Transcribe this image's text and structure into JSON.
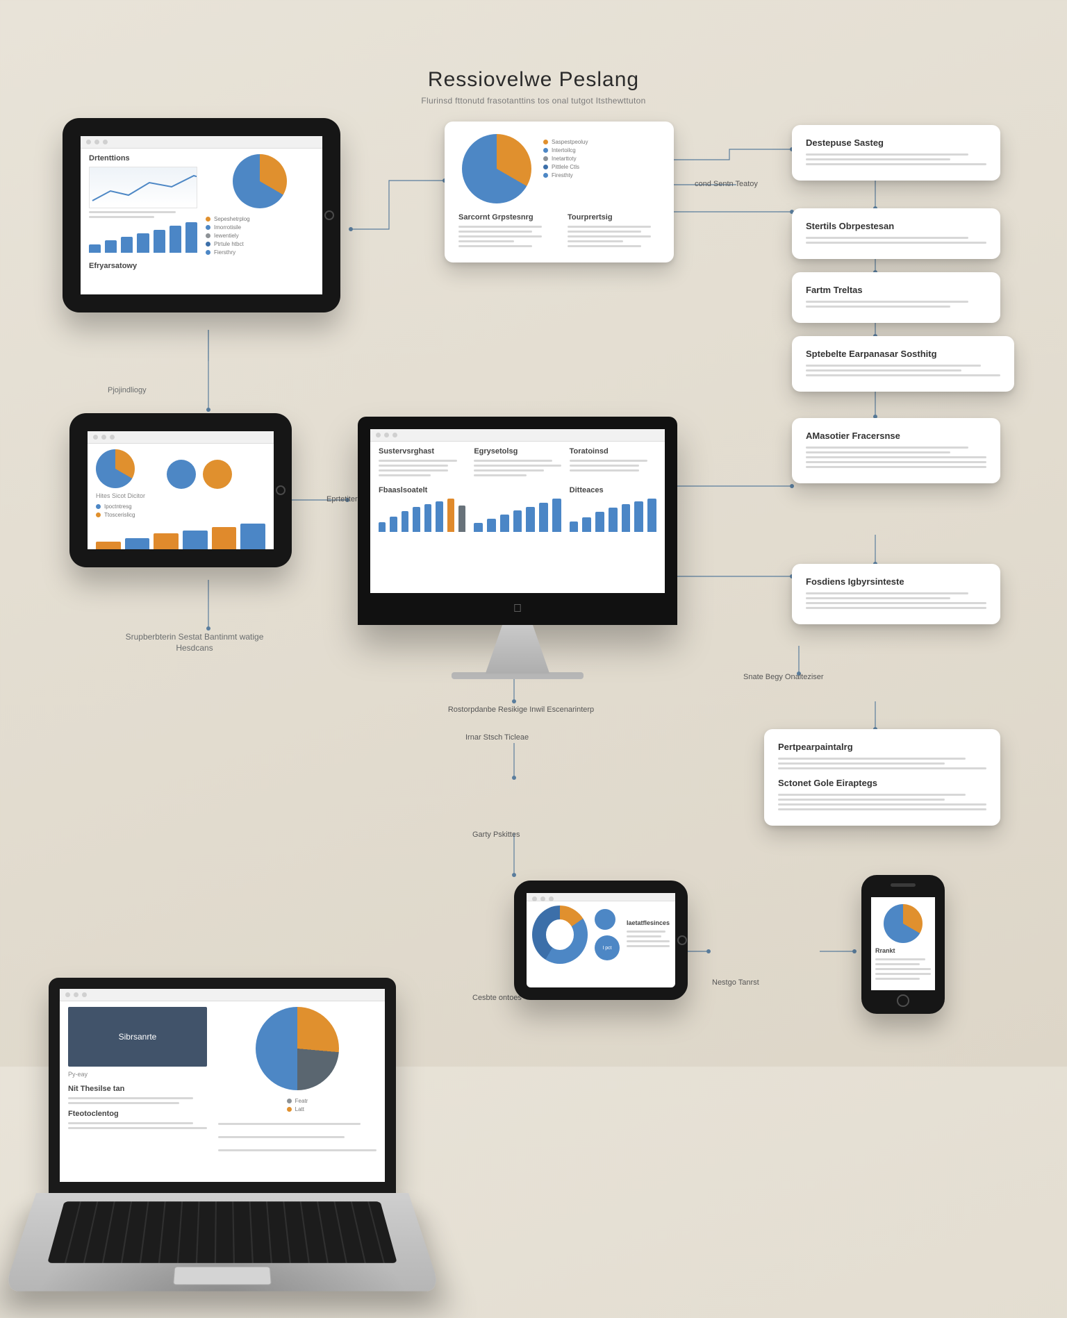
{
  "header": {
    "title": "Ressiovelwe Peslang",
    "subtitle": "Flurinsd fttonutd frasotanttins tos onal tutgot Itsthewttuton"
  },
  "callouts": {
    "c1": "cond Sentn Teatoy",
    "c2": "Eprtetiter",
    "c3": "Pjojindliogy",
    "c4": "Srupberbterin Sestat Bantinmt watige Hesdcans",
    "c5": "Rostorpdanbe Resikige Inwil Escenarinterp",
    "c6": "Irnar Stsch Ticleae",
    "c7": "Garty Pskittes",
    "c8": "Cesbte ontoes",
    "c9": "Nestgo Tanrst",
    "c10": "Snate Begy Onalteziser"
  },
  "devices": {
    "tablet1": {
      "leftTitle": "Drtenttions",
      "rightTitle": "",
      "bottomLeft": "Efryarsatowy",
      "legend": [
        "Sepeshetrplog",
        "Imorrotisile",
        "Iewentiely",
        "Ptrtule htbct",
        "Fiersthry"
      ]
    },
    "tablet2": {
      "leftTitle": "Hites Sicot Dicitor",
      "rightTitle": "",
      "legend": [
        "Ipoctntresg",
        "Ttoscerislicg"
      ]
    },
    "imac": {
      "colA": "Sustervsrghast",
      "colB": "Egrysetolsg",
      "colC": "Toratoinsd",
      "rowB_A": "Fbaaslsoatelt",
      "rowB_B": "Ditteaces"
    },
    "laptop": {
      "hero": "Sibrsanrte",
      "tag": "Py-eay",
      "panelA": "Nit Thesilse tan",
      "panelB": "Fteotoclentog",
      "legend": [
        "Featr",
        "Latt"
      ]
    },
    "smallTablet": {
      "title": "Iaetatflesinces"
    },
    "phone": {
      "title": "Rrankt"
    }
  },
  "pieCard": {
    "leftTitle": "Sarcornt Grpstesnrg",
    "rightTitle": "Tourprertsig",
    "legend": [
      "Saspestpeoluy",
      "Intertoilcg",
      "Inetarttoty",
      "Pittlele Ctls",
      "Firesthty"
    ]
  },
  "sideCards": [
    {
      "title": "Destepuse Sasteg"
    },
    {
      "title": "Stertils Obrpestesan"
    },
    {
      "title": "Fartm Treltas"
    },
    {
      "title": "Sptebelte Earpanasar Sosthitg"
    },
    {
      "title": "AMasotier Fracersnse"
    },
    {
      "title": "Fosdiens Igbyrsinteste"
    },
    {
      "title": "Pertpearpaintalrg"
    },
    {
      "title": "Sctonet Gole Eiraptegs"
    }
  ],
  "chart_data": [
    {
      "type": "bar",
      "location": "tablet-top-left bottom-left",
      "categories": [
        "1",
        "2",
        "3",
        "4",
        "5",
        "6",
        "7"
      ],
      "values": [
        18,
        26,
        34,
        42,
        50,
        58,
        66
      ],
      "color": "#4d87c5"
    },
    {
      "type": "pie",
      "location": "tablet-top-left right",
      "series": [
        {
          "name": "orange",
          "value": 33,
          "color": "#e0902e"
        },
        {
          "name": "blue",
          "value": 67,
          "color": "#4d87c5"
        }
      ]
    },
    {
      "type": "pie",
      "location": "center-card",
      "series": [
        {
          "name": "orange",
          "value": 33,
          "color": "#e0902e"
        },
        {
          "name": "blue",
          "value": 67,
          "color": "#4d87c5"
        }
      ]
    },
    {
      "type": "pie",
      "location": "tablet-mid-left left",
      "series": [
        {
          "name": "orange",
          "value": 30,
          "color": "#e0902e"
        },
        {
          "name": "blue",
          "value": 70,
          "color": "#4d87c5"
        }
      ]
    },
    {
      "type": "bar",
      "location": "tablet-mid-left bottom",
      "categories": [
        "1",
        "2",
        "3",
        "4",
        "5",
        "6"
      ],
      "values": [
        20,
        28,
        40,
        46,
        54,
        60
      ],
      "color_alt": [
        "#4d87c5",
        "#e0902e"
      ]
    },
    {
      "type": "bar",
      "location": "imac bottom row (3 mini charts)",
      "series": [
        {
          "name": "A",
          "values": [
            20,
            30,
            44,
            52,
            60,
            66,
            72,
            58
          ],
          "colors": "mix"
        },
        {
          "name": "B",
          "values": [
            18,
            26,
            34,
            42,
            50,
            58,
            66
          ],
          "colors": "blue"
        },
        {
          "name": "C",
          "values": [
            22,
            30,
            42,
            50,
            58,
            64,
            70
          ],
          "colors": "blue"
        }
      ]
    },
    {
      "type": "pie",
      "location": "laptop right",
      "series": [
        {
          "name": "orange",
          "value": 26,
          "color": "#e0902e"
        },
        {
          "name": "grey",
          "value": 24,
          "color": "#5a6670"
        },
        {
          "name": "blue",
          "value": 50,
          "color": "#4d87c5"
        }
      ]
    },
    {
      "type": "pie",
      "location": "small-tablet donut",
      "donut": true,
      "series": [
        {
          "name": "orange",
          "value": 15,
          "color": "#e0902e"
        },
        {
          "name": "blue",
          "value": 43,
          "color": "#4d87c5"
        },
        {
          "name": "dk-blue",
          "value": 42,
          "color": "#3c6fa9"
        }
      ]
    },
    {
      "type": "pie",
      "location": "phone",
      "series": [
        {
          "name": "orange",
          "value": 35,
          "color": "#e0902e"
        },
        {
          "name": "blue",
          "value": 65,
          "color": "#4d87c5"
        }
      ]
    }
  ]
}
